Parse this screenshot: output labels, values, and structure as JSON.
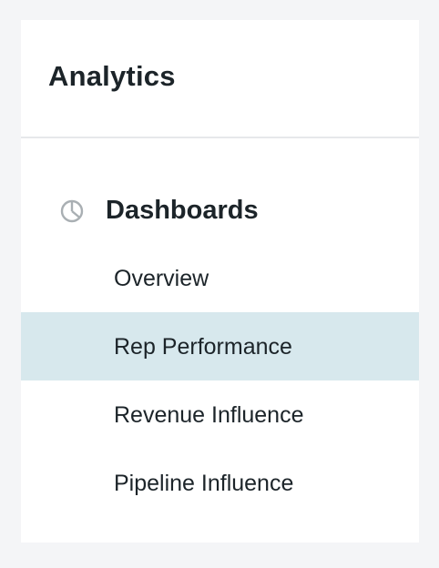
{
  "panel": {
    "title": "Analytics"
  },
  "section": {
    "label": "Dashboards",
    "icon": "pie-chart-icon",
    "icon_color": "#a9afb3"
  },
  "nav": {
    "items": [
      {
        "label": "Overview",
        "active": false
      },
      {
        "label": "Rep Performance",
        "active": true
      },
      {
        "label": "Revenue Influence",
        "active": false
      },
      {
        "label": "Pipeline Influence",
        "active": false
      }
    ]
  },
  "colors": {
    "background": "#f4f5f7",
    "panel": "#ffffff",
    "text": "#1c2429",
    "active_item": "#d7e8ed",
    "divider": "#e6e8eb"
  }
}
